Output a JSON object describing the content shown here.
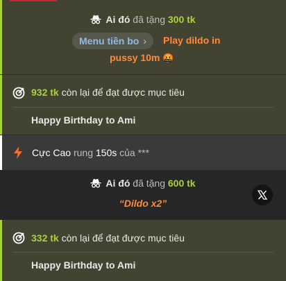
{
  "gift1": {
    "sender": "Ai đó",
    "verb": "đã tặng",
    "amount": "300 tk",
    "menu_label": "Menu tiền bo",
    "action_line1": "Play dildo in",
    "action_line2": "pussy 10m",
    "emoji": "🤬"
  },
  "goal1": {
    "amount": "932 tk",
    "text": "còn lại để đạt được mục tiêu",
    "title": "Happy Birthday to Ami"
  },
  "vibe": {
    "level": "Cực Cao",
    "verb": "rung",
    "duration": "150s",
    "of": "của",
    "user": "***"
  },
  "gift2": {
    "sender": "Ai đó",
    "verb": "đã tặng",
    "amount": "600 tk",
    "message": "“Dildo x2”"
  },
  "goal2": {
    "amount": "332 tk",
    "text": "còn lại để đạt được mục tiêu",
    "title": "Happy Birthday to Ami"
  },
  "colors": {
    "accent_green": "#a9d23a",
    "accent_orange": "#ff8a3d",
    "link_blue": "#8fb9e6",
    "olive_bg": "#434331"
  }
}
